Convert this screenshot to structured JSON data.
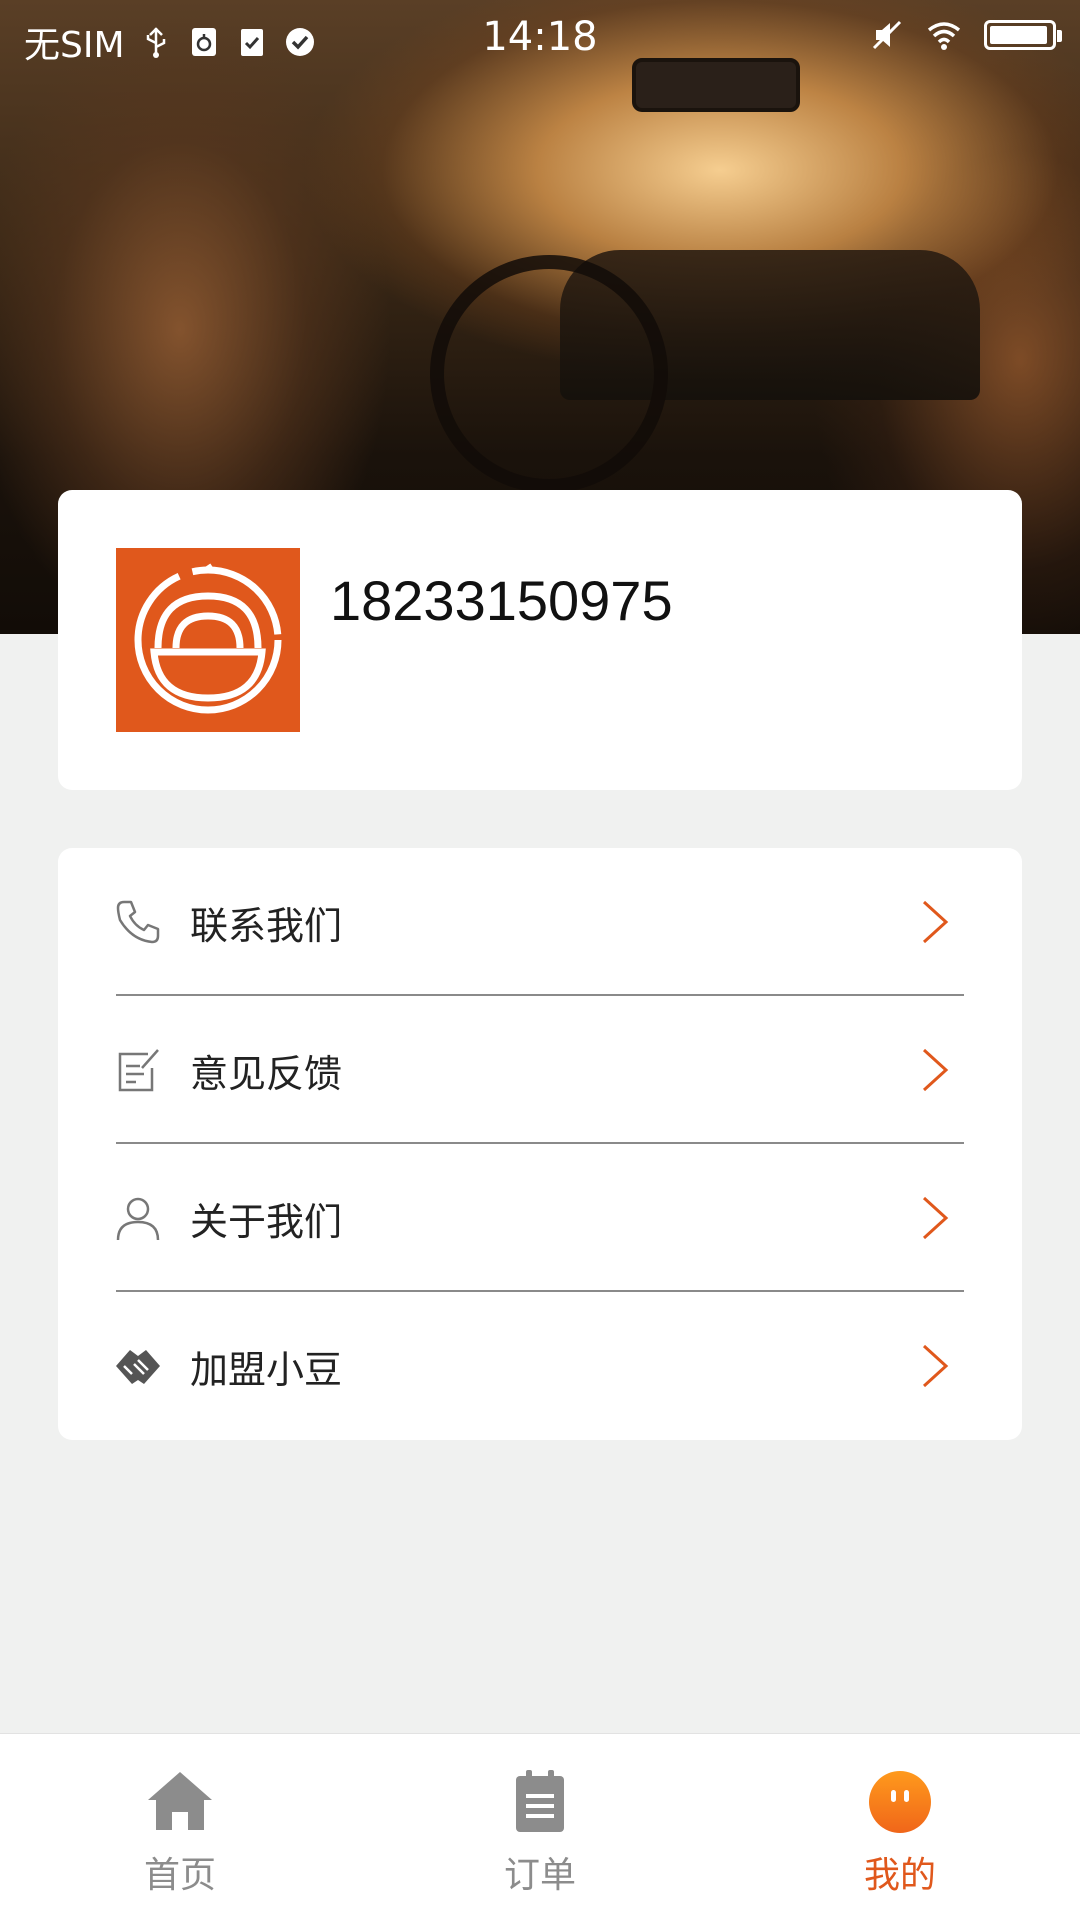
{
  "status_bar": {
    "carrier": "无SIM",
    "time": "14:18",
    "battery_level": 0.95
  },
  "profile": {
    "phone": "18233150975",
    "logo_icon": "bowl-logo-icon",
    "logo_color": "#e0581c"
  },
  "menu": {
    "items": [
      {
        "label": "联系我们",
        "icon": "phone-icon"
      },
      {
        "label": "意见反馈",
        "icon": "feedback-edit-icon"
      },
      {
        "label": "关于我们",
        "icon": "user-icon"
      },
      {
        "label": "加盟小豆",
        "icon": "handshake-icon"
      }
    ],
    "arrow_color": "#e0581c"
  },
  "tab_bar": {
    "tabs": [
      {
        "label": "首页",
        "icon": "home-icon",
        "active": false
      },
      {
        "label": "订单",
        "icon": "order-clipboard-icon",
        "active": false
      },
      {
        "label": "我的",
        "icon": "profile-face-icon",
        "active": true
      }
    ],
    "active_color": "#e0581c",
    "inactive_color": "#8c8c8c"
  }
}
